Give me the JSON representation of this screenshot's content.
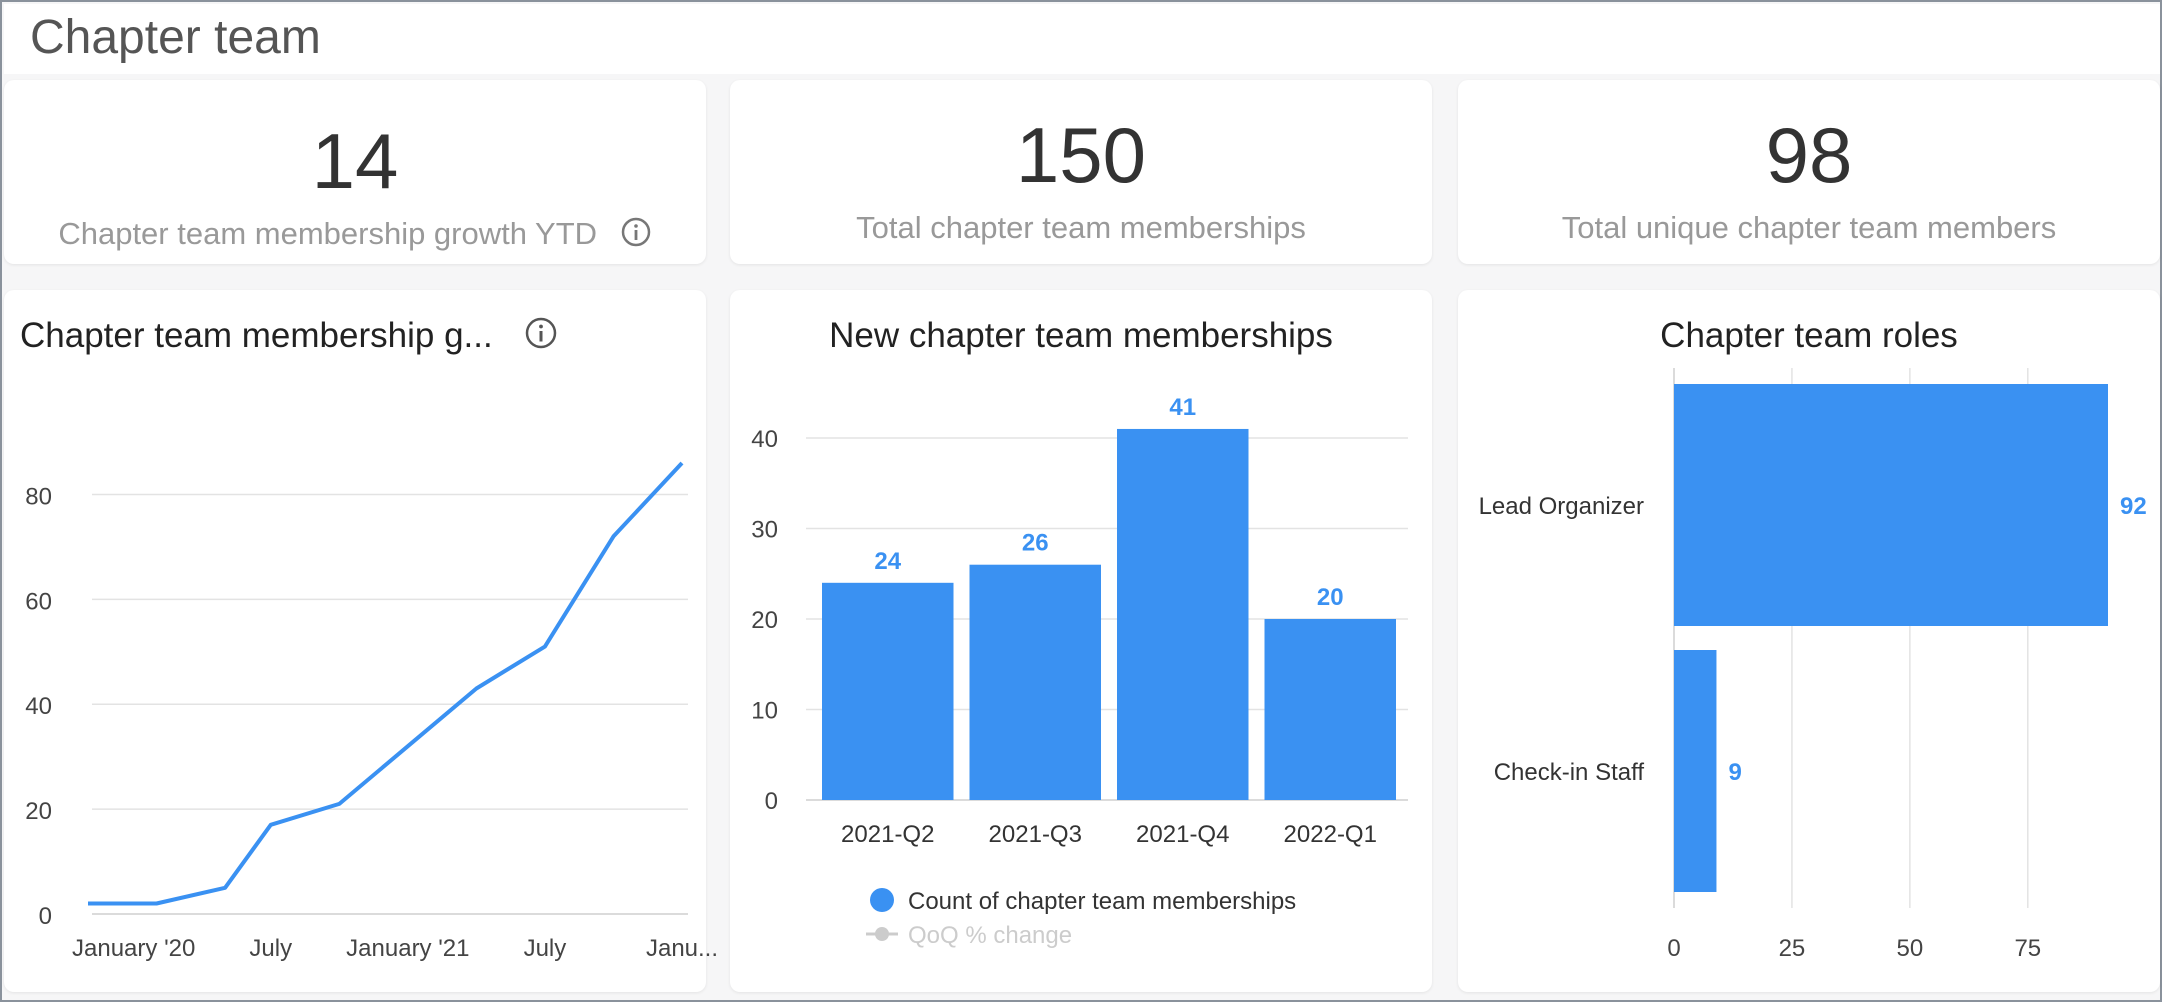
{
  "page": {
    "title": "Chapter team"
  },
  "kpis": [
    {
      "value": "14",
      "label": "Chapter team membership growth YTD",
      "has_info": true
    },
    {
      "value": "150",
      "label": "Total chapter team memberships",
      "has_info": false
    },
    {
      "value": "98",
      "label": "Total unique chapter team members",
      "has_info": false
    }
  ],
  "colors": {
    "accent": "#3a91f2",
    "grid": "#e3e3e3",
    "axis_text": "#444",
    "muted": "#cccccc"
  },
  "chart_data": [
    {
      "type": "line",
      "title": "Chapter team membership g...",
      "x": [
        "2019-11",
        "2020-02",
        "2020-05",
        "2020-07",
        "2020-10",
        "2021-01",
        "2021-04",
        "2021-07",
        "2021-10",
        "2022-01"
      ],
      "series": [
        {
          "values": [
            2,
            2,
            5,
            17,
            21,
            32,
            43,
            51,
            72,
            86
          ]
        }
      ],
      "xticks": [
        {
          "label": "January '20",
          "x": "2020-01"
        },
        {
          "label": "July",
          "x": "2020-07"
        },
        {
          "label": "January '21",
          "x": "2021-01"
        },
        {
          "label": "July",
          "x": "2021-07"
        },
        {
          "label": "Janu...",
          "x": "2022-01"
        }
      ],
      "yticks": [
        0,
        20,
        40,
        60,
        80
      ],
      "ylim": [
        0,
        90
      ],
      "grid": true
    },
    {
      "type": "bar",
      "title": "New chapter team memberships",
      "categories": [
        "2021-Q2",
        "2021-Q3",
        "2021-Q4",
        "2022-Q1"
      ],
      "series": [
        {
          "name": "Count of chapter team memberships",
          "values": [
            24,
            26,
            41,
            20
          ]
        }
      ],
      "legend": [
        {
          "name": "Count of chapter team memberships",
          "style": "dot",
          "active": true
        },
        {
          "name": "QoQ % change",
          "style": "line-dot",
          "active": false
        }
      ],
      "yticks": [
        0,
        10,
        20,
        30,
        40
      ],
      "ylim": [
        0,
        40
      ],
      "grid": true,
      "data_labels": true
    },
    {
      "type": "bar",
      "orientation": "horizontal",
      "title": "Chapter team roles",
      "categories": [
        "Lead Organizer",
        "Check-in Staff"
      ],
      "values": [
        92,
        9
      ],
      "xticks": [
        0,
        25,
        50,
        75
      ],
      "xlim": [
        0,
        92
      ],
      "grid": true,
      "data_labels": true
    }
  ]
}
